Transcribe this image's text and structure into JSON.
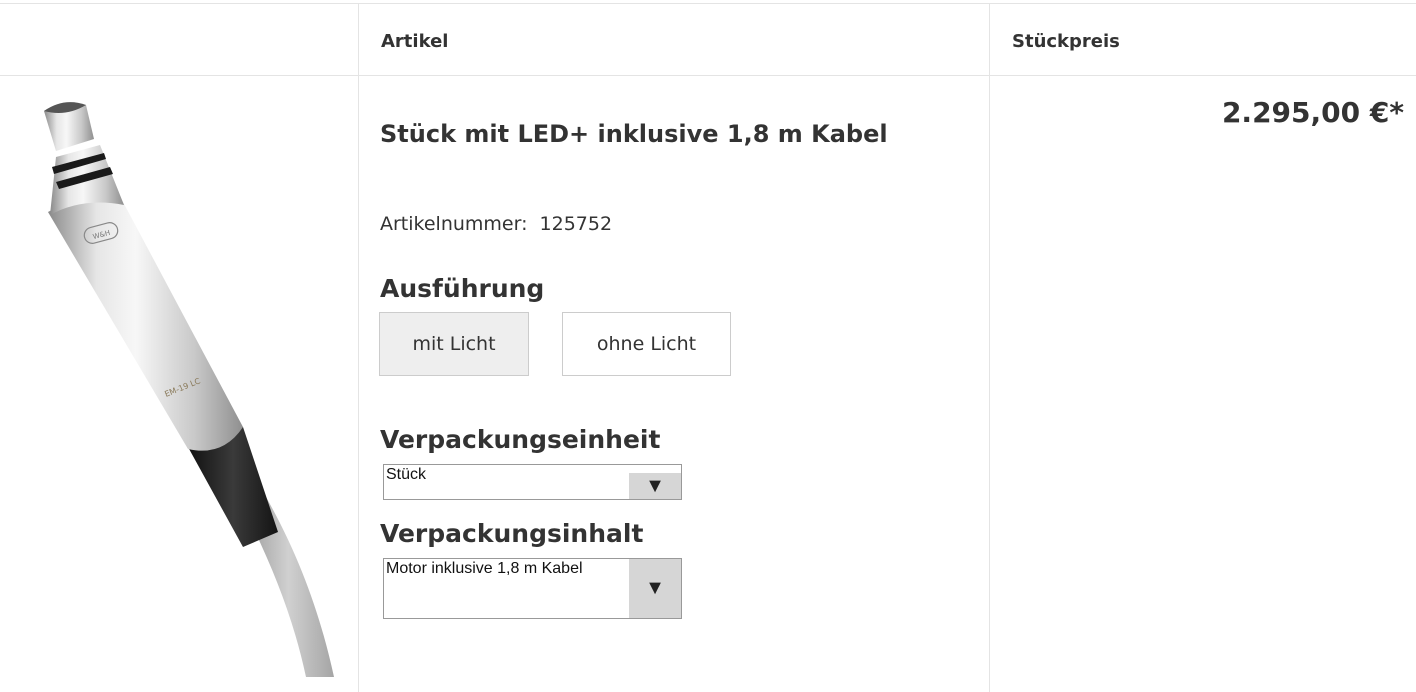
{
  "table": {
    "header": {
      "article": "Artikel",
      "unit_price": "Stückpreis"
    }
  },
  "product": {
    "title": "Stück mit LED+ inklusive 1,8 m Kabel",
    "article_number_label": "Artikelnummer:",
    "article_number": "125752",
    "image_text": {
      "brand": "W&H",
      "model": "EM-19 LC"
    },
    "price": "2.295,00 €*"
  },
  "variants": {
    "ausfuehrung": {
      "label": "Ausführung",
      "options": [
        "mit Licht",
        "ohne Licht"
      ],
      "selected": "mit Licht"
    },
    "verpackungseinheit": {
      "label": "Verpackungseinheit",
      "value": "Stück"
    },
    "verpackungsinhalt": {
      "label": "Verpackungsinhalt",
      "value": "Motor inklusive 1,8 m Kabel"
    }
  },
  "icons": {
    "select_arrow": "chevron-down-icon"
  },
  "colors": {
    "border": "#e4e4e4",
    "selected_bg": "#eeeeee",
    "select_arrow_bg": "#d6d6d6"
  }
}
